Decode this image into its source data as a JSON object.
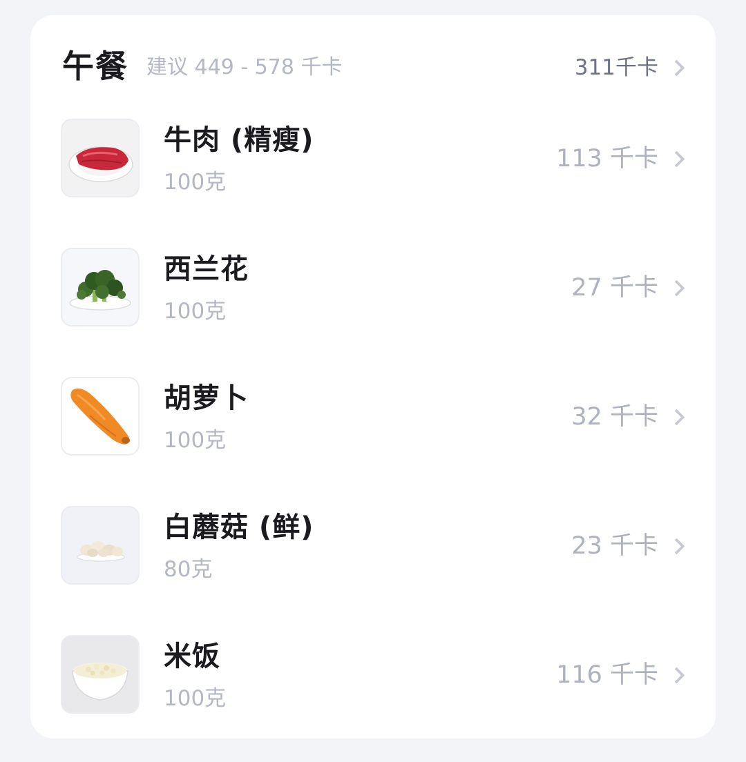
{
  "meal": {
    "title": "午餐",
    "suggestion": "建议 449 - 578 千卡",
    "total": "311千卡"
  },
  "items": [
    {
      "name": "牛肉 (精瘦)",
      "qty": "100克",
      "kcal": "113 千卡",
      "icon": "beef-icon"
    },
    {
      "name": "西兰花",
      "qty": "100克",
      "kcal": "27 千卡",
      "icon": "broccoli-icon"
    },
    {
      "name": "胡萝卜",
      "qty": "100克",
      "kcal": "32 千卡",
      "icon": "carrot-icon"
    },
    {
      "name": "白蘑菇 (鲜)",
      "qty": "80克",
      "kcal": "23 千卡",
      "icon": "mushroom-icon"
    },
    {
      "name": "米饭",
      "qty": "100克",
      "kcal": "116 千卡",
      "icon": "rice-icon"
    }
  ],
  "colors": {
    "page_bg": "#f3f4f8",
    "card_bg": "#ffffff",
    "title": "#1b1b1f",
    "muted": "#b4b8c4",
    "total": "#6e7383",
    "chevron": "#c7cad3"
  }
}
